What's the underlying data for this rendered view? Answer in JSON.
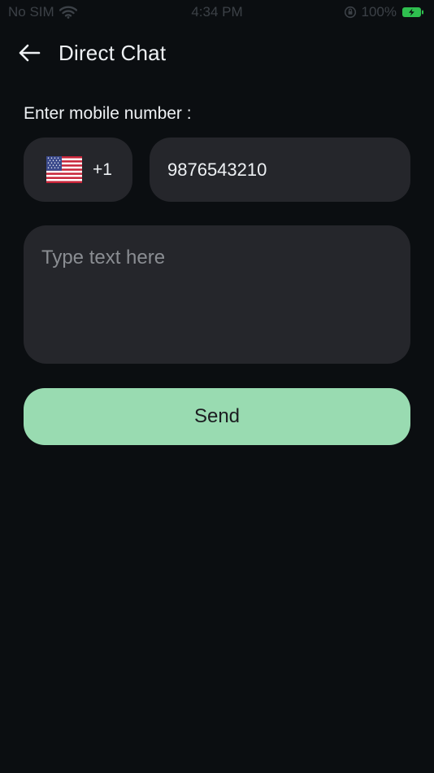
{
  "status_bar": {
    "carrier": "No SIM",
    "time": "4:34 PM",
    "battery": "100%",
    "icons": [
      "wifi-icon",
      "orientation-lock-icon",
      "battery-icon"
    ]
  },
  "header": {
    "title": "Direct Chat",
    "back_icon": "arrow-left-icon"
  },
  "form": {
    "phone_label": "Enter mobile number :",
    "country": {
      "flag": "us-flag-icon",
      "dial_code": "+1"
    },
    "phone_value": "9876543210",
    "message_placeholder": "Type text here",
    "message_value": ""
  },
  "actions": {
    "send_label": "Send"
  },
  "colors": {
    "background": "#0b0e11",
    "field": "#25262b",
    "accent": "#99dbb1",
    "text": "#eef1f4",
    "placeholder": "#8a8d92"
  }
}
